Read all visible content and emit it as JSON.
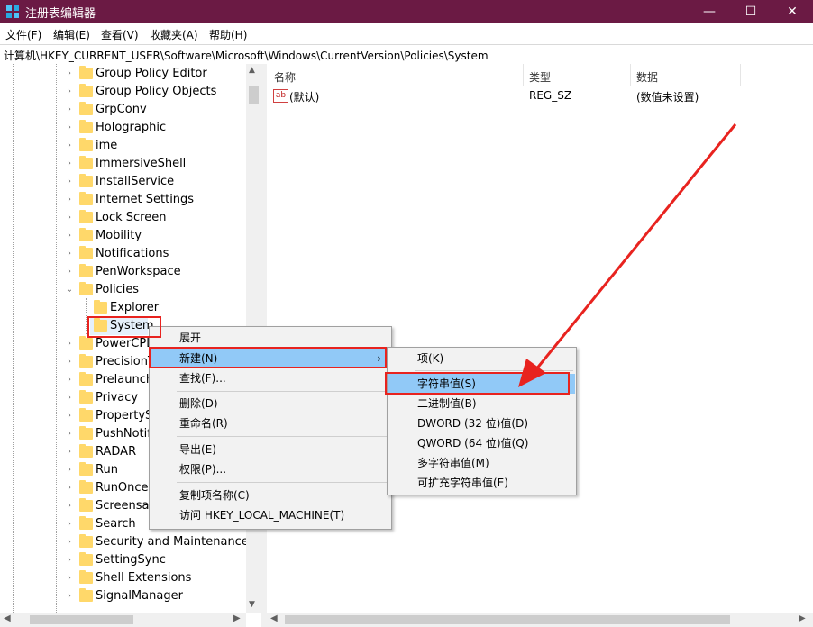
{
  "window": {
    "title": "注册表编辑器",
    "minimize": "—",
    "maximize": "☐",
    "close": "✕",
    "titlebar_color": "#6b1a44"
  },
  "menubar": {
    "file": "文件(F)",
    "edit": "编辑(E)",
    "view": "查看(V)",
    "favorites": "收藏夹(A)",
    "help": "帮助(H)"
  },
  "address": "计算机\\HKEY_CURRENT_USER\\Software\\Microsoft\\Windows\\CurrentVersion\\Policies\\System",
  "tree": {
    "items": [
      {
        "label": "Group Policy Editor",
        "expandable": true
      },
      {
        "label": "Group Policy Objects",
        "expandable": true
      },
      {
        "label": "GrpConv",
        "expandable": true
      },
      {
        "label": "Holographic",
        "expandable": true
      },
      {
        "label": "ime",
        "expandable": true
      },
      {
        "label": "ImmersiveShell",
        "expandable": true
      },
      {
        "label": "InstallService",
        "expandable": true
      },
      {
        "label": "Internet Settings",
        "expandable": true
      },
      {
        "label": "Lock Screen",
        "expandable": true
      },
      {
        "label": "Mobility",
        "expandable": true
      },
      {
        "label": "Notifications",
        "expandable": true
      },
      {
        "label": "PenWorkspace",
        "expandable": true
      },
      {
        "label": "Policies",
        "expanded": true
      },
      {
        "label": "Explorer",
        "child": true
      },
      {
        "label": "System",
        "child": true,
        "selected": true
      },
      {
        "label": "PowerCPL",
        "expandable": true
      },
      {
        "label": "PrecisionT",
        "expandable": true
      },
      {
        "label": "Prelaunch",
        "expandable": true
      },
      {
        "label": "Privacy",
        "expandable": true
      },
      {
        "label": "PropertySy",
        "expandable": true
      },
      {
        "label": "PushNotifi",
        "expandable": true
      },
      {
        "label": "RADAR",
        "expandable": true
      },
      {
        "label": "Run",
        "expandable": true
      },
      {
        "label": "RunOnce",
        "expandable": true
      },
      {
        "label": "Screensav",
        "expandable": true
      },
      {
        "label": "Search",
        "expandable": true
      },
      {
        "label": "Security and Maintenance",
        "expandable": true
      },
      {
        "label": "SettingSync",
        "expandable": true
      },
      {
        "label": "Shell Extensions",
        "expandable": true
      },
      {
        "label": "SignalManager",
        "expandable": true
      }
    ]
  },
  "list": {
    "columns": {
      "name": "名称",
      "type": "类型",
      "data": "数据"
    },
    "rows": [
      {
        "icon": "ab",
        "name": "(默认)",
        "type": "REG_SZ",
        "data": "(数值未设置)"
      }
    ]
  },
  "context_menu": {
    "expand": "展开",
    "new": "新建(N)",
    "find": "查找(F)...",
    "delete": "删除(D)",
    "rename": "重命名(R)",
    "export": "导出(E)",
    "permissions": "权限(P)...",
    "copy_key_name": "复制项名称(C)",
    "visit_hklm": "访问 HKEY_LOCAL_MACHINE(T)"
  },
  "submenu": {
    "key": "项(K)",
    "string_value": "字符串值(S)",
    "binary_value": "二进制值(B)",
    "dword_value": "DWORD (32 位)值(D)",
    "qword_value": "QWORD (64 位)值(Q)",
    "multi_string_value": "多字符串值(M)",
    "expandable_string_value": "可扩充字符串值(E)"
  },
  "annotation_color": "#e8231f",
  "highlight_color": "#91c9f7"
}
